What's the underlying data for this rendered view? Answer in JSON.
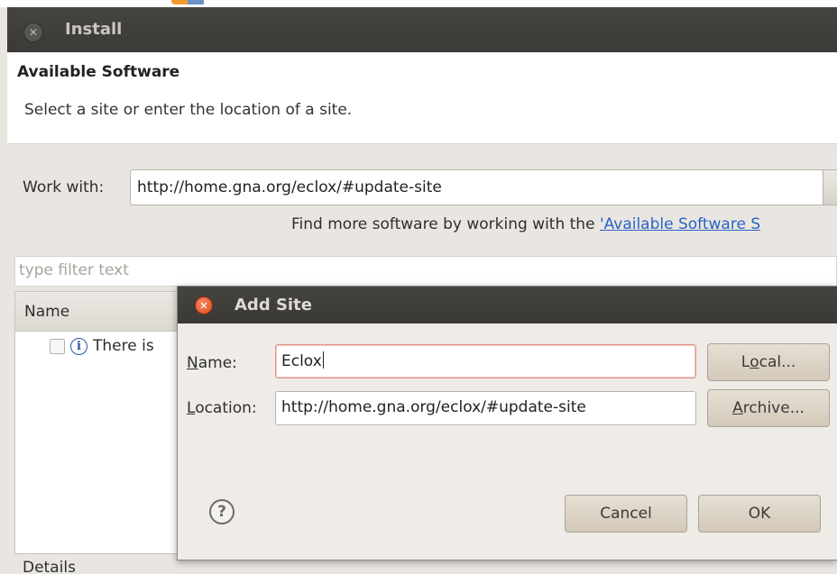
{
  "install_window": {
    "title": "Install",
    "header_title": "Available Software",
    "header_subtitle": "Select a site or enter the location of a site.",
    "work_with_label": "Work with:",
    "work_with_value": "http://home.gna.org/eclox/#update-site",
    "find_more_prefix": "Find more software by working with the ",
    "find_more_link": "'Available Software S",
    "filter_placeholder": "type filter text",
    "tree_header": "Name",
    "tree_item": "There is",
    "details_label": "Details"
  },
  "add_site_dialog": {
    "title": "Add Site",
    "name_label_accel": "N",
    "name_label_rest": "ame:",
    "name_value": "Eclox",
    "location_label_accel": "L",
    "location_label_rest": "ocation:",
    "location_value": "http://home.gna.org/eclox/#update-site",
    "local_button_pre": "L",
    "local_button_accel": "o",
    "local_button_post": "cal...",
    "archive_button_accel": "A",
    "archive_button_rest": "rchive...",
    "help_symbol": "?",
    "cancel_label": "Cancel",
    "ok_label": "OK"
  },
  "icons": {
    "window_close": "close-icon",
    "dialog_close": "close-icon",
    "info": "info-icon",
    "help": "help-icon"
  }
}
